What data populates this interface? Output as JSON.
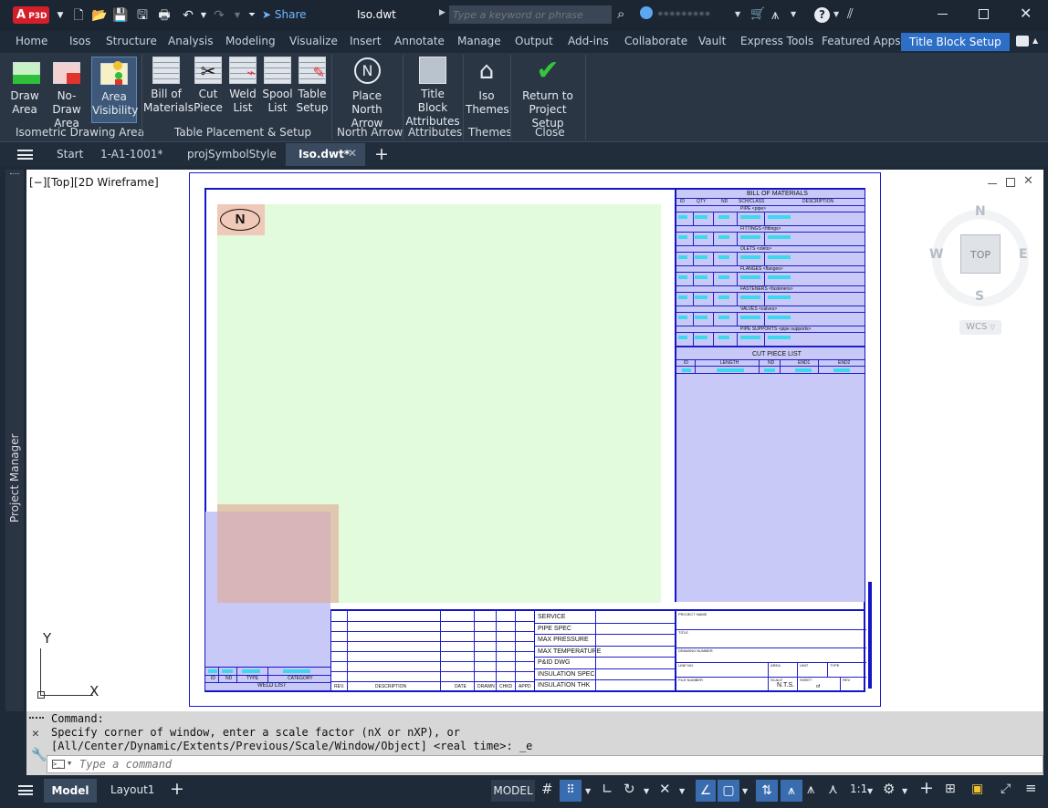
{
  "titlebar": {
    "logo": "P3D",
    "file_title": "Iso.dwt",
    "share_label": "Share",
    "search_placeholder": "Type a keyword or phrase",
    "user_name": "•••••••••"
  },
  "ribbon_tabs": [
    "Home",
    "Isos",
    "Structure",
    "Analysis",
    "Modeling",
    "Visualize",
    "Insert",
    "Annotate",
    "Manage",
    "Output",
    "Add-ins",
    "Collaborate",
    "Vault",
    "Express Tools",
    "Featured Apps",
    "Title Block Setup"
  ],
  "ribbon": {
    "draw_area": [
      "Draw",
      "Area"
    ],
    "no_draw_area": [
      "No-Draw",
      "Area"
    ],
    "area_visibility": [
      "Area",
      "Visibility"
    ],
    "bom": [
      "Bill of",
      "Materials"
    ],
    "cut_piece": [
      "Cut",
      "Piece"
    ],
    "weld_list": [
      "Weld",
      "List"
    ],
    "spool_list": [
      "Spool",
      "List"
    ],
    "table_setup": [
      "Table",
      "Setup"
    ],
    "place_north": [
      "Place",
      "North Arrow"
    ],
    "tb_attr": [
      "Title Block",
      "Attributes"
    ],
    "iso_themes": [
      "Iso",
      "Themes"
    ],
    "return": [
      "Return to",
      "Project Setup"
    ],
    "panels": {
      "iso_area": "Isometric Drawing Area",
      "table": "Table Placement & Setup",
      "north": "North Arrow",
      "attributes": "Attributes",
      "themes": "Themes",
      "close": "Close"
    }
  },
  "doc_tabs": [
    "Start",
    "1-A1-1001*",
    "projSymbolStyle",
    "Iso.dwt*"
  ],
  "sidebar": {
    "label": "Project Manager"
  },
  "viewport": {
    "label": "[−][Top][2D Wireframe]"
  },
  "viewcube": {
    "n": "N",
    "s": "S",
    "e": "E",
    "w": "W",
    "top": "TOP",
    "wcs": "WCS"
  },
  "ucs": {
    "x": "X",
    "y": "Y"
  },
  "drawing": {
    "north": "N",
    "bom_title": "BILL OF MATERIALS",
    "bom_cols": [
      "ID",
      "QTY",
      "ND",
      "SCH/CLASS",
      "DESCRIPTION"
    ],
    "bom_sections": [
      "PIPE <pipe>",
      "FITTINGS <fittings>",
      "OLETS <olets>",
      "FLANGES <flanges>",
      "FASTENERS <fasteners>",
      "VALVES <valves>",
      "PIPE SUPPORTS <pipe supports>"
    ],
    "cut_title": "CUT PIECE LIST",
    "cut_cols": [
      "ID",
      "LENGTH",
      "ND",
      "END1",
      "END2"
    ],
    "weld_title": "WELD LIST",
    "weld_cols": [
      "ID",
      "ND",
      "TYPE",
      "CATEGORY"
    ],
    "rev_cols": [
      "REV.",
      "DESCRIPTION",
      "DATE",
      "DRAWN",
      "CHKD",
      "APPD"
    ],
    "props": [
      "SERVICE",
      "PIPE SPEC",
      "MAX PRESSURE",
      "MAX TEMPERATURE",
      "P&ID DWG",
      "INSULATION SPEC",
      "INSULATION THK"
    ],
    "tb": {
      "project": "PROJECT NAME",
      "title": "TITLE",
      "drawing": "DRAWING NUMBER",
      "line": "LINE NO.",
      "area": "AREA",
      "unit": "UNIT",
      "type": "TYPE",
      "file": "FILE NUMBER",
      "scale": "SCALE",
      "nts": "N.T.S.",
      "sheet": "SHEET",
      "of": "of",
      "rev": "REV"
    }
  },
  "command": {
    "line1": "Command:",
    "line2": "Specify corner of window, enter a scale factor (nX or nXP), or",
    "line3": "[All/Center/Dynamic/Extents/Previous/Scale/Window/Object] <real time>: _e",
    "placeholder": "Type a command"
  },
  "status": {
    "model_tab": "Model",
    "layout_tab": "Layout1",
    "model_btn": "MODEL",
    "scale": "1:1"
  }
}
